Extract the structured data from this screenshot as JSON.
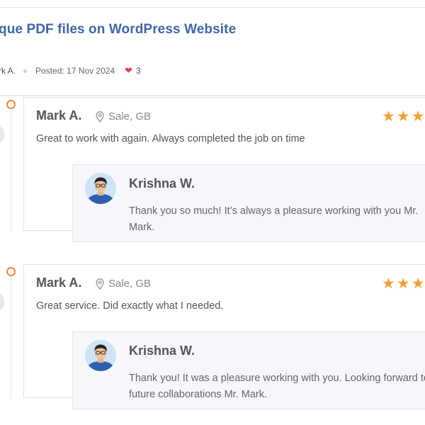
{
  "project": {
    "title": "que PDF files on WordPress Website",
    "author": "rk A.",
    "posted": "Posted: 17 Nov 2024",
    "likes": "3"
  },
  "reviews": [
    {
      "name": "Mark A.",
      "location": "Sale, GB",
      "rating": 3,
      "stars_visible": "★★★",
      "text": "Great to work with again. Always completed the job on time",
      "reply": {
        "name": "Krishna W.",
        "text": "Thank you so much! It’s always a pleasure working with you Mr. Mark."
      }
    },
    {
      "name": "Mark A.",
      "location": "Sale, GB",
      "rating": 3,
      "stars_visible": "★★★",
      "text": "Great service. Did exactly what I needed.",
      "reply": {
        "name": "Krishna W.",
        "text": "Thank you! It was a pleasure working with you. Looking forward to future collaborations Mr. Mark."
      }
    }
  ],
  "colors": {
    "title": "#3e66a8",
    "accent_orange": "#ef8a3c",
    "star": "#efa234",
    "heart": "#e0434e"
  }
}
